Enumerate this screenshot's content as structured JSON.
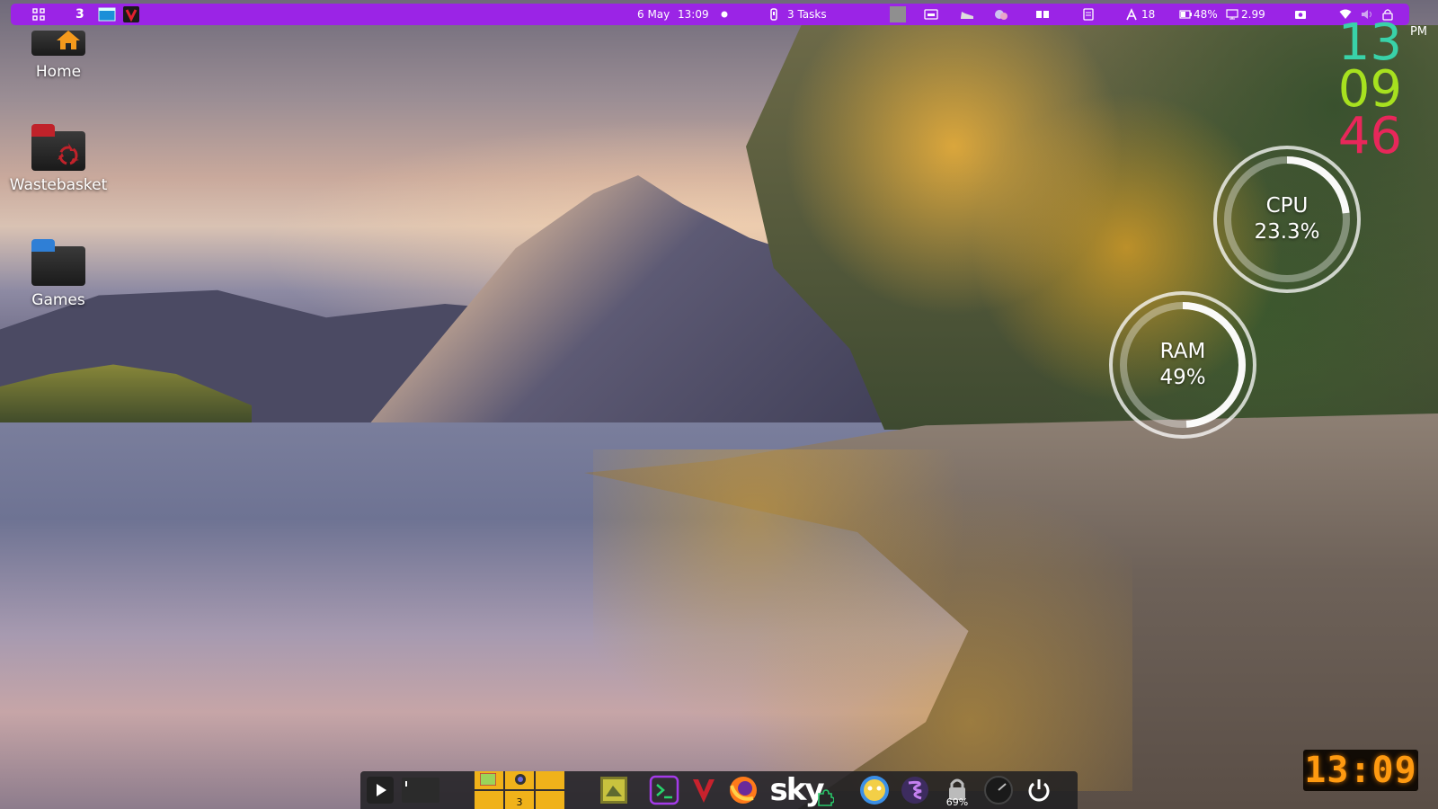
{
  "top_panel": {
    "workspace_number": "3",
    "date": "6 May",
    "time": "13:09",
    "tasks": "3 Tasks",
    "updates_count": "18",
    "battery": "48%",
    "load_average": "2.99"
  },
  "desktop_icons": [
    {
      "label": "Home",
      "icon": "home-folder-icon"
    },
    {
      "label": "Wastebasket",
      "icon": "trash-folder-icon"
    },
    {
      "label": "Games",
      "icon": "games-folder-icon"
    }
  ],
  "clock": {
    "hours": "13",
    "minutes": "09",
    "seconds": "46",
    "period": "PM"
  },
  "gauges": {
    "cpu": {
      "label": "CPU",
      "value": "23.3%",
      "fraction": 0.233
    },
    "ram": {
      "label": "RAM",
      "value": "49%",
      "fraction": 0.49
    }
  },
  "digital_clock": {
    "time": "13:09"
  },
  "dock": {
    "pager_active_label": "3",
    "sky_label": "sky",
    "lock_percent": "69%",
    "colors": {
      "pager": "#f0b21a",
      "panel": "#9b24e6"
    }
  }
}
